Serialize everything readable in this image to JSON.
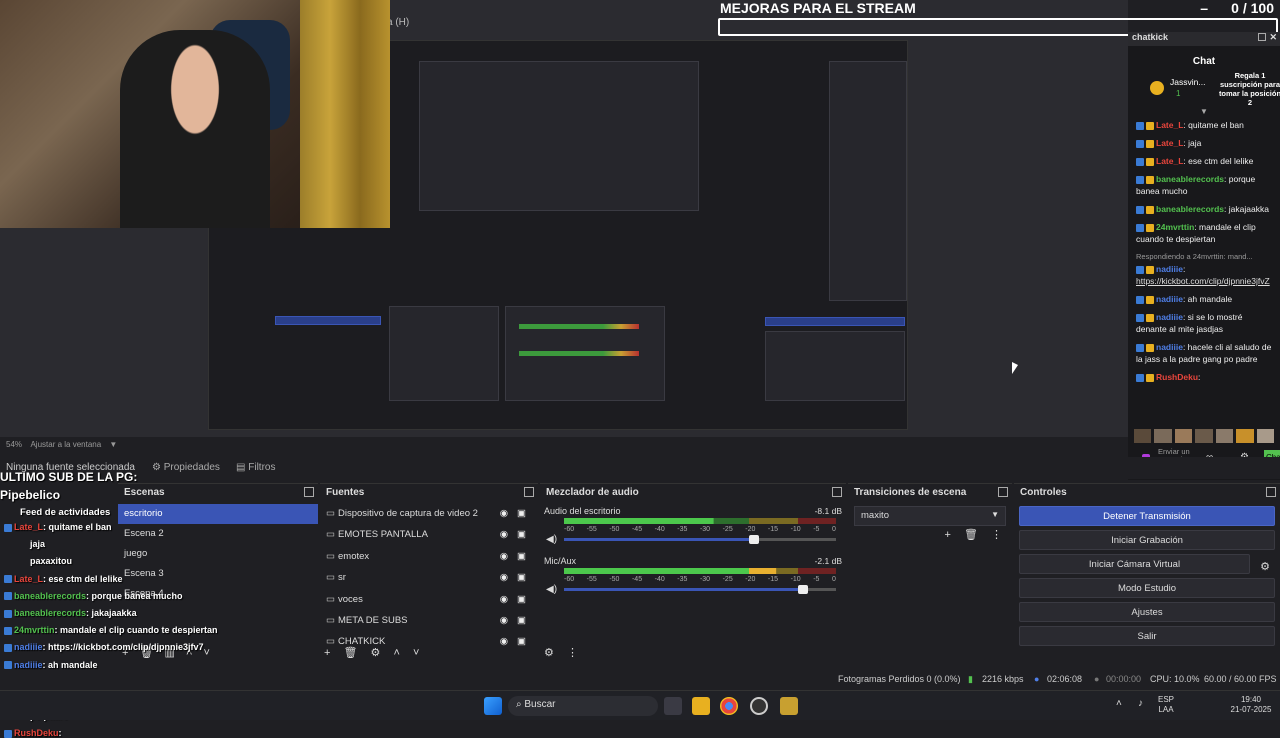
{
  "goal": {
    "title": "MEJORAS PARA EL STREAM",
    "count": "0",
    "separator": "/ 100",
    "dash": "–"
  },
  "menu_fragment": "a (H)",
  "chat": {
    "header": "chatkick",
    "title": "Chat",
    "sub_user": "Jassvin...",
    "sub_count": "1",
    "sub_text": "Regala 1 suscripción para tomar la posición 2",
    "messages": [
      {
        "user": "Late_L",
        "text": ": quitame el ban",
        "color": "red"
      },
      {
        "user": "Late_L",
        "text": ": jaja",
        "color": "red"
      },
      {
        "user": "Late_L",
        "text": ": ese ctm del lelike",
        "color": "red"
      },
      {
        "user": "baneablerecords",
        "text": ": porque banea mucho",
        "color": "green"
      },
      {
        "user": "baneablerecords",
        "text": ": jakajaakka",
        "color": "green"
      },
      {
        "user": "24mvrttin",
        "text": ": mandale el clip cuando te despiertan",
        "color": "green"
      },
      {
        "user": "nadiiie",
        "text": ":",
        "color": "blue",
        "reply": "Respondiendo a 24mvrttin: mand...",
        "link": "https://kickbot.com/clip/djpnnie3jfvZ"
      },
      {
        "user": "nadiiie",
        "text": ": ah mandale",
        "color": "blue"
      },
      {
        "user": "nadiiie",
        "text": ": si se lo mostré denante al mite jasdjas",
        "color": "blue"
      },
      {
        "user": "nadiiie",
        "text": ": hacele cli al saludo de la jass a la padre gang po padre",
        "color": "blue"
      },
      {
        "user": "RushDeku",
        "text": ":",
        "color": "red"
      }
    ],
    "send_label": "Enviar un mensaje",
    "chat_btn": "Chat"
  },
  "zoom": {
    "value": "54%",
    "label": "Ajustar a la ventana"
  },
  "source_bar": {
    "none": "Ninguna fuente seleccionada",
    "properties": "Propiedades",
    "filters": "Filtros"
  },
  "scenes": {
    "title": "Escenas",
    "items": [
      "escritorio",
      "Escena 2",
      "juego",
      "Escena 3",
      "Escena 4"
    ]
  },
  "sources": {
    "title": "Fuentes",
    "items": [
      "Dispositivo de captura de video 2",
      "EMOTES PANTALLA",
      "emotex",
      "sr",
      "voces",
      "META DE SUBS",
      "CHATKICK"
    ]
  },
  "mixer": {
    "title": "Mezclador de audio",
    "channels": [
      {
        "name": "Audio del escritorio",
        "db": "-8.1 dB",
        "level": 0.55,
        "volume": 0.7
      },
      {
        "name": "Mic/Aux",
        "db": "-2.1 dB",
        "level": 0.78,
        "volume": 0.88
      }
    ],
    "ticks": [
      "-60",
      "-55",
      "-50",
      "-45",
      "-40",
      "-35",
      "-30",
      "-25",
      "-20",
      "-15",
      "-10",
      "-5",
      "0"
    ]
  },
  "transitions": {
    "title": "Transiciones de escena",
    "selected": "maxito"
  },
  "controls": {
    "title": "Controles",
    "buttons": [
      "Detener Transmisión",
      "Iniciar Grabación",
      "Iniciar Cámara Virtual",
      "Modo Estudio",
      "Ajustes",
      "Salir"
    ]
  },
  "overlay": {
    "sub_title": "ULTIMO SUB DE LA PG:",
    "sub_name": "Pipebelico",
    "feed": "Feed de actividades",
    "messages": [
      {
        "user": "Late_L",
        "text": ": quitame el ban"
      },
      {
        "user": "",
        "text": "jaja"
      },
      {
        "user": "",
        "text": "paxaxitou"
      },
      {
        "user": "Late_L",
        "text": ": ese ctm del lelike"
      },
      {
        "user": "baneablerecords",
        "text": ": porque banea mucho"
      },
      {
        "user": "baneablerecords",
        "text": ": jakajaakka"
      },
      {
        "user": "24mvrttin",
        "text": ": mandale el clip cuando te despiertan"
      },
      {
        "user": "nadiiie",
        "text": ": https://kickbot.com/clip/djpnnie3jfv7"
      },
      {
        "user": "nadiiie",
        "text": ": ah mandale"
      },
      {
        "user": "nadiiie",
        "text": ": si se lo mostre denante al mite jasdjas"
      },
      {
        "user": "nadiiie",
        "text": ": hacele cli al saludo de la jass a la padre gang"
      },
      {
        "user": "",
        "text": "po padre"
      },
      {
        "user": "RushDeku",
        "text": ":"
      }
    ]
  },
  "status": {
    "dropped": "Fotogramas Perdidos 0 (0.0%)",
    "bitrate": "2216 kbps",
    "live_time": "02:06:08",
    "rec_time": "00:00:00",
    "cpu": "CPU: 10.0%",
    "fps": "60.00 / 60.00 FPS"
  },
  "taskbar": {
    "search": "Buscar",
    "lang1": "ESP",
    "lang2": "LAA",
    "time": "19:40",
    "date": "21-07-2025"
  },
  "colors": {
    "accent": "#3a55b5",
    "panel": "#1f1f23",
    "chat_bg": "#18181b"
  }
}
